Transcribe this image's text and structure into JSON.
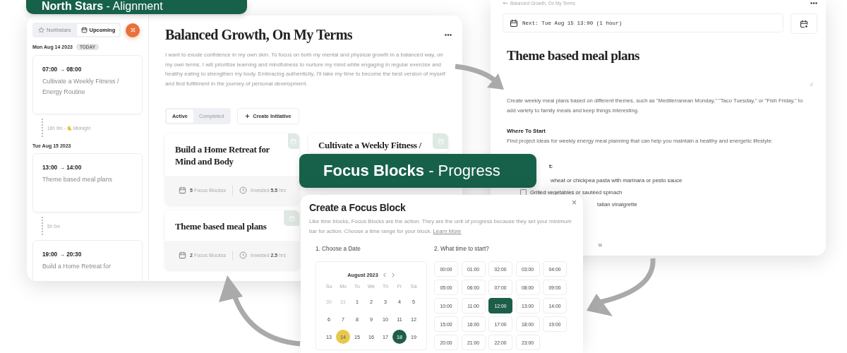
{
  "banners": [
    {
      "text": "**North Stars** - Alignment"
    },
    {
      "text": "**Focus Blocks** - Progress"
    }
  ],
  "northstar_window": {
    "sidebar": {
      "tabs": [
        {
          "label": "Northstars",
          "selected": false
        },
        {
          "label": "Upcoming",
          "selected": true
        }
      ],
      "timeline": [
        {
          "kind": "day",
          "date": "Mon Aug 14 2023",
          "badge": "TODAY"
        },
        {
          "kind": "event",
          "time": "07:00 → 08:00",
          "title": "Cultivate a Weekly Fitness / Energy Routine"
        },
        {
          "kind": "gap",
          "duration": "16h 0m -",
          "label": "Midnight"
        },
        {
          "kind": "day",
          "date": "Tue Aug 15 2023"
        },
        {
          "kind": "event",
          "time": "13:00 → 14:00",
          "title": "Theme based meal plans"
        },
        {
          "kind": "gap",
          "duration": "5h 0m"
        },
        {
          "kind": "event",
          "time": "19:00 → 20:30",
          "title": "Build a Home Retreat for"
        }
      ]
    },
    "title": "Balanced Growth, On My Terms",
    "description": "I want to exude confidence in my own skin. To focus on both my mental and physical growth in a balanced way, on my own terms. I will prioritize learning and mindfulness to nurture my mind while engaging in regular exercise and healthy eating to strengthen my body. Embracing authenticity, I'll take my time to become the best version of myself and find fulfillment in the journey of personal development.",
    "filter_tabs": [
      {
        "label": "Active",
        "selected": true
      },
      {
        "label": "Completed",
        "selected": false
      }
    ],
    "create_button": "Create Initiative",
    "initiatives": [
      {
        "title": "Build a Home Retreat for Mind and Body",
        "focus_blocks": "**5** Focus Blockss",
        "invested": "Invested **5.5** hrs"
      },
      {
        "title": "Cultivate a Weekly Fitness /"
      },
      {
        "title": "Theme based meal plans",
        "focus_blocks": "**2** Focus Blockss",
        "invested": "Invested **2.5** hrs"
      }
    ]
  },
  "detail_window": {
    "breadcrumb": "Balanced Growth, On My Terms",
    "next": "Next: Tue Aug 15 13:00 (1 hour)",
    "title": "Theme based meal plans",
    "description": "Create weekly meal plans based on different themes, such as \"Mediterranean Monday,\" \"Taco Tuesday,\" or \"Fish Friday,\" to add variety to family meals and keep things interesting.",
    "section_heading": "Where To Start",
    "section_text": "Find project ideas for weekly energy meal planning that can help you maintain a healthy and energetic lifestyle:",
    "partial_lines": [
      {
        "kind": "heading",
        "text": "t:"
      },
      {
        "kind": "item",
        "text": "wheat or chickpea pasta with marinara or pesto sauce"
      },
      {
        "kind": "checkbox",
        "text": "Grilled vegetables or sautéed spinach",
        "checked": false
      },
      {
        "kind": "item",
        "text": "talian vinaigrette"
      },
      {
        "kind": "item",
        "text": "u"
      }
    ]
  },
  "focus_dialog": {
    "title": "Create a Focus Block",
    "description": "Like time blocks, Focus Blocks are the action. They are the unit of progress because they set your minimum bar for action. Choose a time range for your block.",
    "link": "Learn More",
    "close": "×",
    "date_label": "1. Choose a Date",
    "time_label": "2. What time to start?",
    "month": "August 2023",
    "weekdays": [
      "Su",
      "Mo",
      "Tu",
      "We",
      "Th",
      "Fr",
      "Sa"
    ],
    "days": [
      {
        "label": "30",
        "outside": true,
        "today": false,
        "selected": false
      },
      {
        "label": "31",
        "outside": true,
        "today": false,
        "selected": false
      },
      {
        "label": "1",
        "outside": false,
        "today": false,
        "selected": false
      },
      {
        "label": "2",
        "outside": false,
        "today": false,
        "selected": false
      },
      {
        "label": "3",
        "outside": false,
        "today": false,
        "selected": false
      },
      {
        "label": "4",
        "outside": false,
        "today": false,
        "selected": false
      },
      {
        "label": "5",
        "outside": false,
        "today": false,
        "selected": false
      },
      {
        "label": "6",
        "outside": false,
        "today": false,
        "selected": false
      },
      {
        "label": "7",
        "outside": false,
        "today": false,
        "selected": false
      },
      {
        "label": "8",
        "outside": false,
        "today": false,
        "selected": false
      },
      {
        "label": "9",
        "outside": false,
        "today": false,
        "selected": false
      },
      {
        "label": "10",
        "outside": false,
        "today": false,
        "selected": false
      },
      {
        "label": "11",
        "outside": false,
        "today": false,
        "selected": false
      },
      {
        "label": "12",
        "outside": false,
        "today": false,
        "selected": false
      },
      {
        "label": "13",
        "outside": false,
        "today": false,
        "selected": false
      },
      {
        "label": "14",
        "outside": false,
        "today": true,
        "selected": false
      },
      {
        "label": "15",
        "outside": false,
        "today": false,
        "selected": false
      },
      {
        "label": "16",
        "outside": false,
        "today": false,
        "selected": false
      },
      {
        "label": "17",
        "outside": false,
        "today": false,
        "selected": false
      },
      {
        "label": "18",
        "outside": false,
        "today": false,
        "selected": true
      },
      {
        "label": "19",
        "outside": false,
        "today": false,
        "selected": false
      }
    ],
    "times": [
      {
        "label": "00:00",
        "selected": false
      },
      {
        "label": "01:00",
        "selected": false
      },
      {
        "label": "02:00",
        "selected": false
      },
      {
        "label": "03:00",
        "selected": false
      },
      {
        "label": "04:00",
        "selected": false
      },
      {
        "label": "05:00",
        "selected": false
      },
      {
        "label": "06:00",
        "selected": false
      },
      {
        "label": "07:00",
        "selected": false
      },
      {
        "label": "08:00",
        "selected": false
      },
      {
        "label": "09:00",
        "selected": false
      },
      {
        "label": "10:00",
        "selected": false
      },
      {
        "label": "11:00",
        "selected": false
      },
      {
        "label": "12:00",
        "selected": true
      },
      {
        "label": "13:00",
        "selected": false
      },
      {
        "label": "14:00",
        "selected": false
      },
      {
        "label": "15:00",
        "selected": false
      },
      {
        "label": "16:00",
        "selected": false
      },
      {
        "label": "17:00",
        "selected": false
      },
      {
        "label": "18:00",
        "selected": false
      },
      {
        "label": "19:00",
        "selected": false
      },
      {
        "label": "20:00",
        "selected": false
      },
      {
        "label": "21:00",
        "selected": false
      },
      {
        "label": "22:00",
        "selected": false
      },
      {
        "label": "23:00",
        "selected": false
      }
    ]
  }
}
